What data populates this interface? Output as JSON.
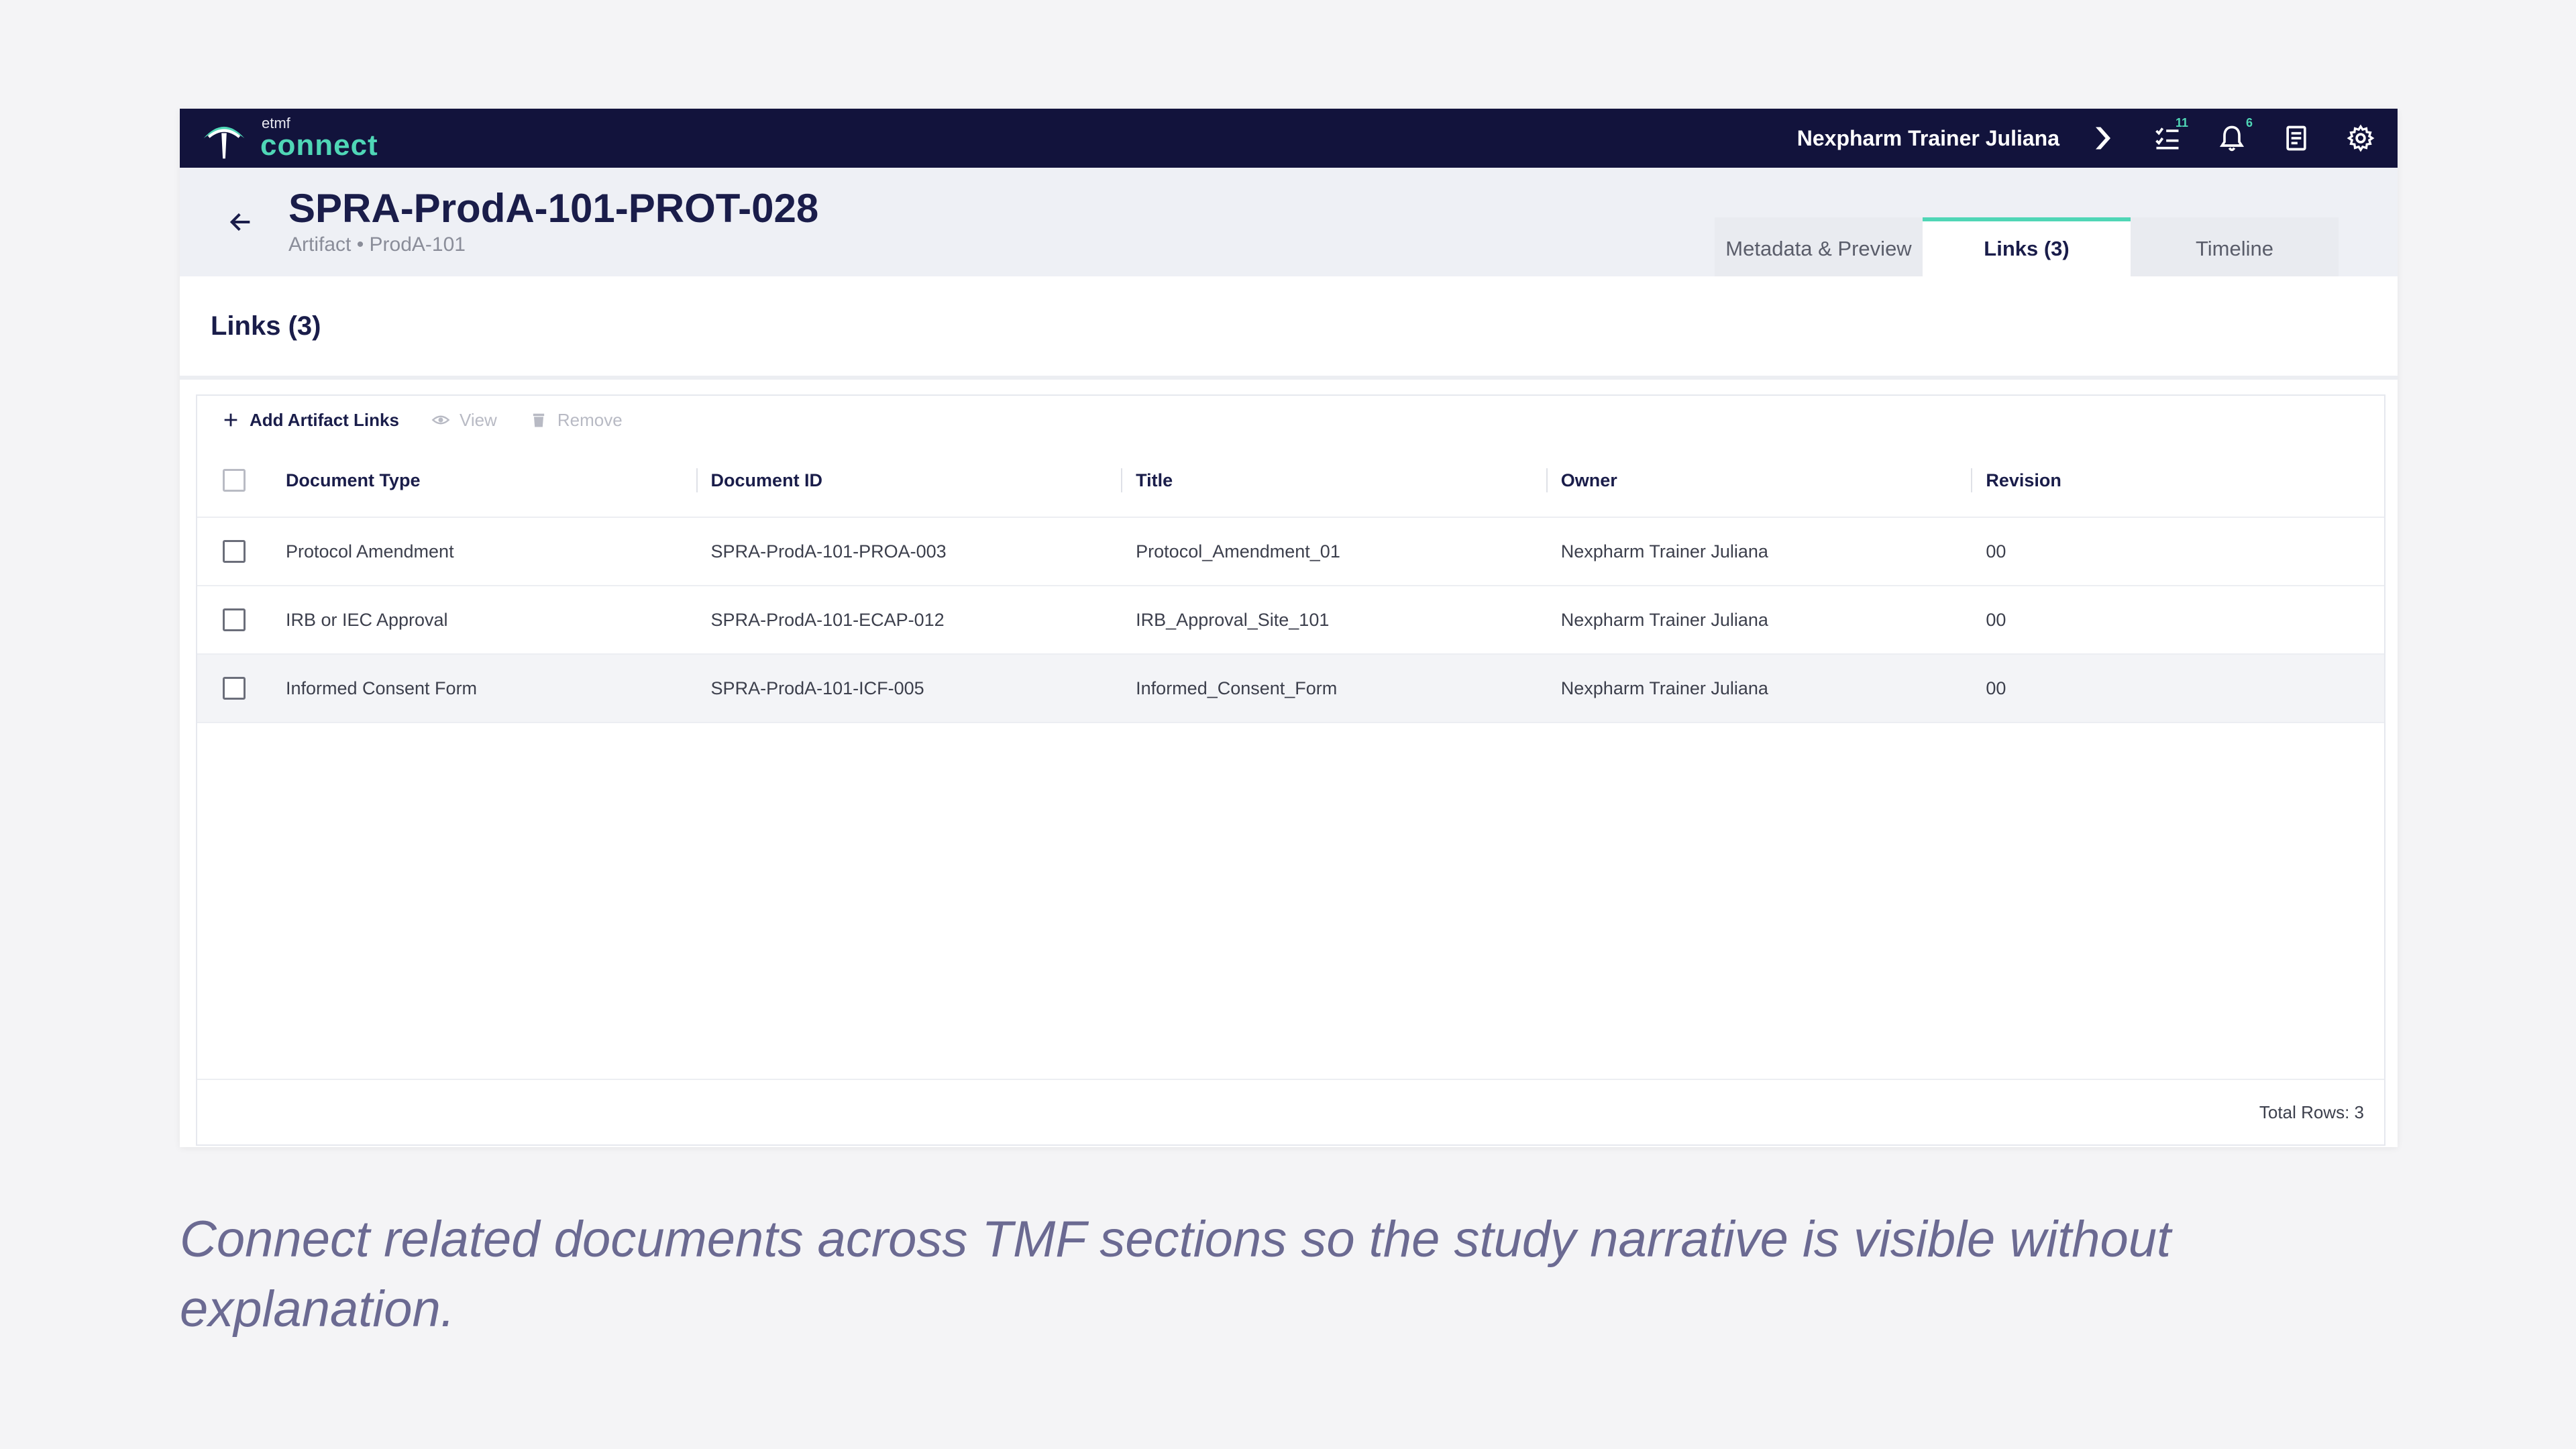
{
  "app": {
    "logo_small": "etmf",
    "logo_big": "connect",
    "user_name": "Nexpharm Trainer Juliana",
    "tasks_badge": "11",
    "notifications_badge": "6"
  },
  "header": {
    "title": "SPRA-ProdA-101-PROT-028",
    "subtitle": "Artifact • ProdA-101",
    "tabs": [
      {
        "label": "Metadata & Preview"
      },
      {
        "label": "Links (3)"
      },
      {
        "label": "Timeline"
      }
    ]
  },
  "section": {
    "title": "Links (3)"
  },
  "toolbar": {
    "add_label": "Add Artifact Links",
    "view_label": "View",
    "remove_label": "Remove"
  },
  "grid": {
    "columns": [
      "Document Type",
      "Document ID",
      "Title",
      "Owner",
      "Revision"
    ],
    "rows": [
      [
        "Protocol Amendment",
        "SPRA-ProdA-101-PROA-003",
        "Protocol_Amendment_01",
        "Nexpharm Trainer Juliana",
        "00"
      ],
      [
        "IRB or IEC Approval",
        "SPRA-ProdA-101-ECAP-012",
        "IRB_Approval_Site_101",
        "Nexpharm Trainer Juliana",
        "00"
      ],
      [
        "Informed Consent Form",
        "SPRA-ProdA-101-ICF-005",
        "Informed_Consent_Form",
        "Nexpharm Trainer Juliana",
        "00"
      ]
    ],
    "total_rows": "Total Rows: 3"
  },
  "caption": "Connect related documents across TMF sections so the study narrative is visible without explanation.",
  "colors": {
    "nav_bg": "#12133c",
    "accent": "#4fd6b6",
    "title": "#1a1d4a",
    "caption": "#6b6a92"
  },
  "icons": [
    "logo-icon",
    "share-icon",
    "tasks-icon",
    "bell-icon",
    "document-icon",
    "gear-icon",
    "back-arrow-icon",
    "plus-icon",
    "eye-icon",
    "trash-icon"
  ]
}
